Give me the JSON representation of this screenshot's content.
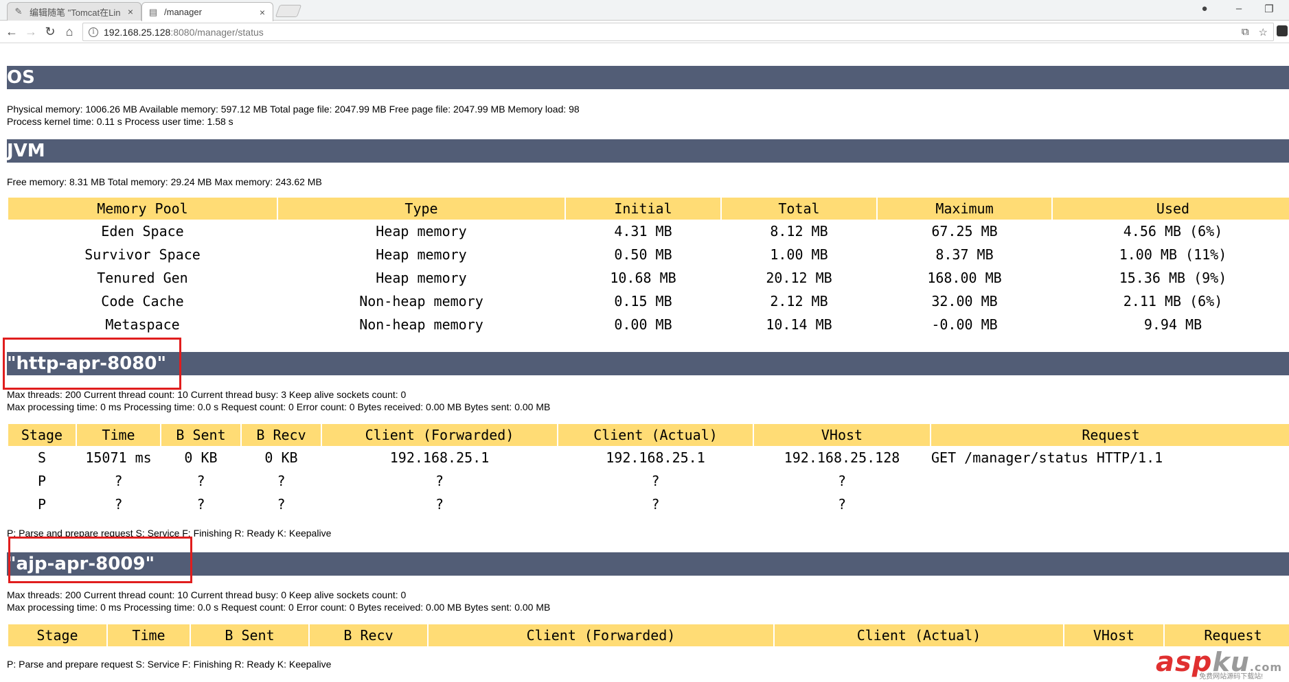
{
  "browser": {
    "tabs": [
      {
        "label": "编辑随笔 \"Tomcat在Lin",
        "icon": "blog-icon",
        "close": "×"
      },
      {
        "label": "/manager",
        "icon": "page-icon",
        "close": "×"
      }
    ],
    "url_host": "192.168.25.128",
    "url_path": ":8080/manager/status",
    "window_controls": {
      "minimize": "–",
      "restore": "❐"
    }
  },
  "os": {
    "title": "OS",
    "line1": "Physical memory: 1006.26 MB Available memory: 597.12 MB Total page file: 2047.99 MB Free page file: 2047.99 MB Memory load: 98",
    "line2": "Process kernel time: 0.11 s Process user time: 1.58 s"
  },
  "jvm": {
    "title": "JVM",
    "line1": "Free memory: 8.31 MB Total memory: 29.24 MB Max memory: 243.62 MB",
    "headers": [
      "Memory Pool",
      "Type",
      "Initial",
      "Total",
      "Maximum",
      "Used"
    ],
    "rows": [
      [
        "Eden Space",
        "Heap memory",
        "4.31 MB",
        "8.12 MB",
        "67.25 MB",
        "4.56 MB (6%)"
      ],
      [
        "Survivor Space",
        "Heap memory",
        "0.50 MB",
        "1.00 MB",
        "8.37 MB",
        "1.00 MB (11%)"
      ],
      [
        "Tenured Gen",
        "Heap memory",
        "10.68 MB",
        "20.12 MB",
        "168.00 MB",
        "15.36 MB (9%)"
      ],
      [
        "Code Cache",
        "Non-heap memory",
        "0.15 MB",
        "2.12 MB",
        "32.00 MB",
        "2.11 MB (6%)"
      ],
      [
        "Metaspace",
        "Non-heap memory",
        "0.00 MB",
        "10.14 MB",
        "-0.00 MB",
        "9.94 MB"
      ]
    ]
  },
  "http": {
    "title": "\"http-apr-8080\"",
    "line1": "Max threads: 200 Current thread count: 10 Current thread busy: 3 Keep alive sockets count: 0",
    "line2": "Max processing time: 0 ms Processing time: 0.0 s Request count: 0 Error count: 0 Bytes received: 0.00 MB Bytes sent: 0.00 MB",
    "headers": [
      "Stage",
      "Time",
      "B Sent",
      "B Recv",
      "Client (Forwarded)",
      "Client (Actual)",
      "VHost",
      "Request"
    ],
    "rows": [
      [
        "S",
        "15071 ms",
        "0 KB",
        "0 KB",
        "192.168.25.1",
        "192.168.25.1",
        "192.168.25.128",
        "GET /manager/status HTTP/1.1"
      ],
      [
        "P",
        "?",
        "?",
        "?",
        "?",
        "?",
        "?",
        ""
      ],
      [
        "P",
        "?",
        "?",
        "?",
        "?",
        "?",
        "?",
        ""
      ]
    ],
    "legend": "P: Parse and prepare request S: Service F: Finishing R: Ready K: Keepalive"
  },
  "ajp": {
    "title": "\"ajp-apr-8009\"",
    "line1": "Max threads: 200 Current thread count: 10 Current thread busy: 0 Keep alive sockets count: 0",
    "line2": "Max processing time: 0 ms Processing time: 0.0 s Request count: 0 Error count: 0 Bytes received: 0.00 MB Bytes sent: 0.00 MB",
    "headers": [
      "Stage",
      "Time",
      "B Sent",
      "B Recv",
      "Client (Forwarded)",
      "Client (Actual)",
      "VHost",
      "Request"
    ],
    "legend": "P: Parse and prepare request S: Service F: Finishing R: Ready K: Keepalive"
  },
  "watermark": {
    "asp": "asp",
    "ku": "ku",
    "com": ".com",
    "sub": "免费网站源码下载站!"
  },
  "colors": {
    "header_bg": "#525d76",
    "table_header_bg": "#ffdc75",
    "highlight": "#e01d1d"
  }
}
